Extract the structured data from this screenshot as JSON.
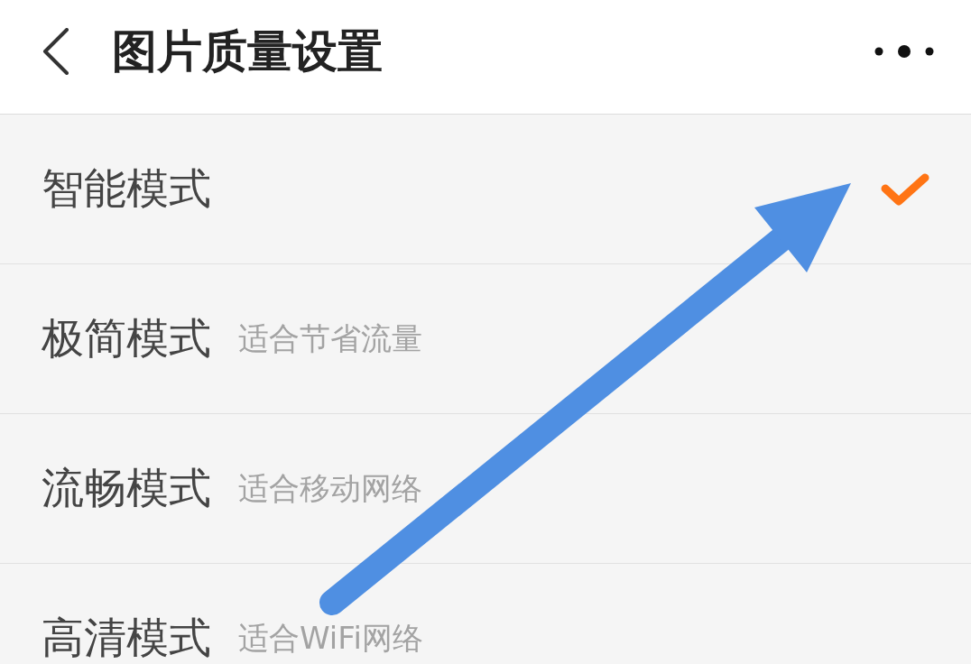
{
  "header": {
    "title": "图片质量设置"
  },
  "options": [
    {
      "label": "智能模式",
      "selected": true
    },
    {
      "label": "极简模式",
      "description": "适合节省流量",
      "selected": false
    },
    {
      "label": "流畅模式",
      "description": "适合移动网络",
      "selected": false
    },
    {
      "label": "高清模式",
      "description": "适合WiFi网络",
      "selected": false
    }
  ]
}
